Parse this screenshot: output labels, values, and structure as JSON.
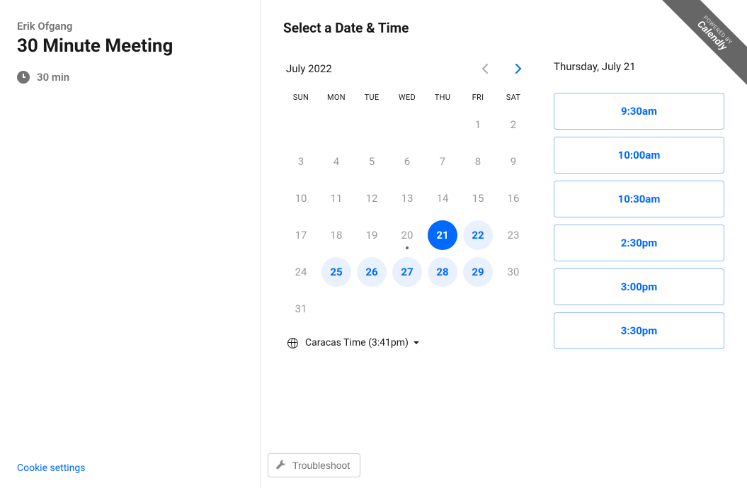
{
  "sidebar": {
    "host": "Erik Ofgang",
    "title": "30 Minute Meeting",
    "duration": "30 min",
    "cookie_link": "Cookie settings"
  },
  "main": {
    "title": "Select a Date & Time",
    "troubleshoot": "Troubleshoot"
  },
  "calendar": {
    "month_label": "July 2022",
    "weekdays": [
      "SUN",
      "MON",
      "TUE",
      "WED",
      "THU",
      "FRI",
      "SAT"
    ],
    "weeks": [
      [
        null,
        null,
        null,
        null,
        null,
        {
          "d": 1
        },
        {
          "d": 2
        }
      ],
      [
        {
          "d": 3
        },
        {
          "d": 4
        },
        {
          "d": 5
        },
        {
          "d": 6
        },
        {
          "d": 7
        },
        {
          "d": 8
        },
        {
          "d": 9
        }
      ],
      [
        {
          "d": 10
        },
        {
          "d": 11
        },
        {
          "d": 12
        },
        {
          "d": 13
        },
        {
          "d": 14
        },
        {
          "d": 15
        },
        {
          "d": 16
        }
      ],
      [
        {
          "d": 17
        },
        {
          "d": 18
        },
        {
          "d": 19
        },
        {
          "d": 20,
          "today": true
        },
        {
          "d": 21,
          "selected": true
        },
        {
          "d": 22,
          "available": true
        },
        {
          "d": 23
        }
      ],
      [
        {
          "d": 24
        },
        {
          "d": 25,
          "available": true
        },
        {
          "d": 26,
          "available": true
        },
        {
          "d": 27,
          "available": true
        },
        {
          "d": 28,
          "available": true
        },
        {
          "d": 29,
          "available": true
        },
        {
          "d": 30
        }
      ],
      [
        {
          "d": 31
        },
        null,
        null,
        null,
        null,
        null,
        null
      ]
    ],
    "timezone_label": "Caracas Time (3:41pm)"
  },
  "timeslots": {
    "date_label": "Thursday, July 21",
    "slots": [
      "9:30am",
      "10:00am",
      "10:30am",
      "2:30pm",
      "3:00pm",
      "3:30pm"
    ]
  },
  "banner": {
    "powered_by": "POWERED BY",
    "brand": "Calendly"
  }
}
